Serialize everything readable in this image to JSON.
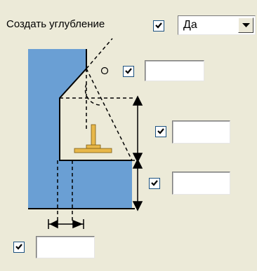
{
  "header": {
    "create_recess_label": "Создать углубление",
    "create_recess_checked": true,
    "create_recess_option": "Да"
  },
  "fields": {
    "angle": {
      "checked": true,
      "value": ""
    },
    "upper_depth": {
      "checked": true,
      "value": ""
    },
    "lower_depth": {
      "checked": true,
      "value": ""
    },
    "width": {
      "checked": true,
      "value": ""
    }
  },
  "icons": {
    "checkbox_check": "check-mark-icon",
    "dropdown": "chevron-down-icon"
  },
  "colors": {
    "background": "#ecead8",
    "material_fill": "#6a9fd4",
    "tool_fill": "#e8b84a",
    "check_color": "#1c5180"
  }
}
